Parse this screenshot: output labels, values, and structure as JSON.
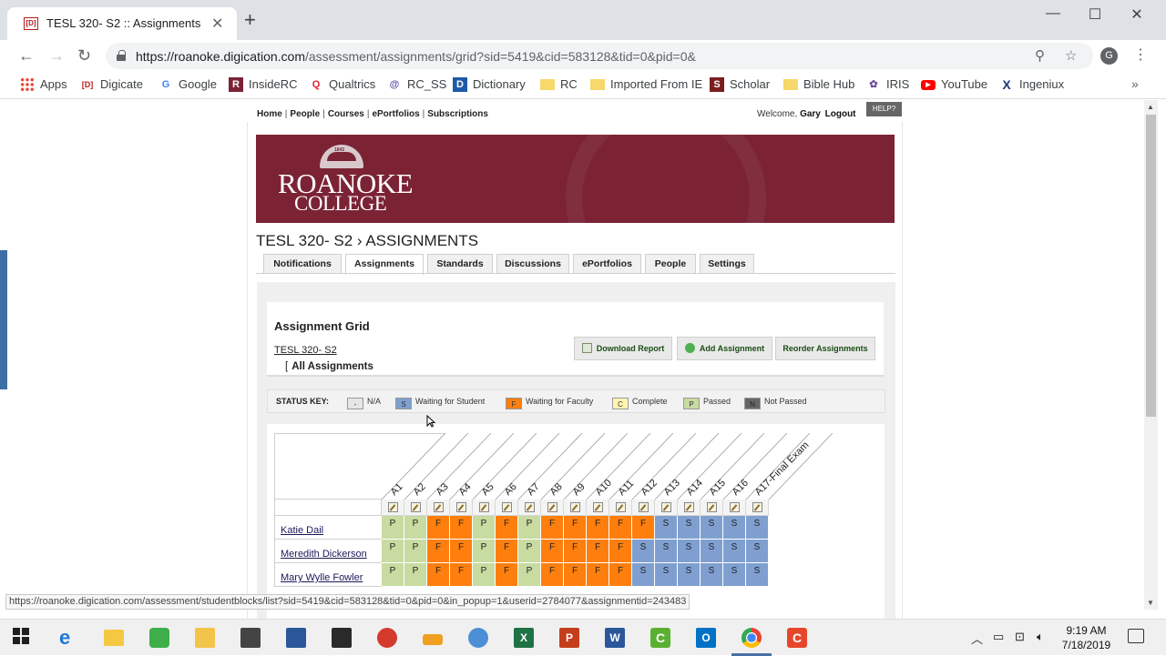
{
  "browser": {
    "tab_title": "TESL 320- S2 :: Assignments",
    "tab_favicon": "[D]",
    "new_tab": "+",
    "url_host": "https://roanoke.digication.com",
    "url_path": "/assessment/assignments/grid?sid=5419&cid=583128&tid=0&pid=0&",
    "profile_initial": "G",
    "bookmarks": [
      {
        "label": "Apps",
        "icon": "apps-grid-icon"
      },
      {
        "label": "Digicate",
        "icon": "[D]"
      },
      {
        "label": "Google",
        "icon": "G"
      },
      {
        "label": "InsideRC",
        "icon": "R"
      },
      {
        "label": "Qualtrics",
        "icon": "Q"
      },
      {
        "label": "RC_SS",
        "icon": "@"
      },
      {
        "label": "Dictionary",
        "icon": "D"
      },
      {
        "label": "RC",
        "icon": "folder-icon"
      },
      {
        "label": "Imported From IE",
        "icon": "folder-icon"
      },
      {
        "label": "Scholar",
        "icon": "S"
      },
      {
        "label": "Bible Hub",
        "icon": "folder-icon"
      },
      {
        "label": "IRIS",
        "icon": "iris-icon"
      },
      {
        "label": "YouTube",
        "icon": "youtube-icon"
      },
      {
        "label": "Ingeniux",
        "icon": "X"
      }
    ],
    "more_bookmarks": "»",
    "status_url": "https://roanoke.digication.com/assessment/studentblocks/list?sid=5419&cid=583128&tid=0&pid=0&in_popup=1&userid=2784077&assignmentid=243483"
  },
  "site": {
    "top_nav": [
      "Home",
      "People",
      "Courses",
      "ePortfolios",
      "Subscriptions"
    ],
    "welcome_prefix": "Welcome,",
    "user_name": "Gary",
    "logout": "Logout",
    "help": "HELP?",
    "logo_year": "1842",
    "logo_line1": "ROANOKE",
    "logo_line2": "COLLEGE"
  },
  "course": {
    "breadcrumb": "TESL 320- S2 › ASSIGNMENTS",
    "tabs": [
      "Notifications",
      "Assignments",
      "Standards",
      "Discussions",
      "ePortfolios",
      "People",
      "Settings"
    ],
    "active_tab": "Assignments"
  },
  "grid": {
    "title": "Assignment Grid",
    "course_link": "TESL 320- S2",
    "filter_bracket": "[",
    "filter": "All Assignments",
    "buttons": {
      "download": "Download Report",
      "add": "Add Assignment",
      "reorder": "Reorder Assignments"
    },
    "status_key_label": "STATUS KEY:",
    "status_key": [
      {
        "code": "-",
        "label": "N/A",
        "color": "#e6e6e6"
      },
      {
        "code": "S",
        "label": "Waiting for Student",
        "color": "#7f9fd0"
      },
      {
        "code": "F",
        "label": "Waiting for Faculty",
        "color": "#ff7f0e"
      },
      {
        "code": "C",
        "label": "Complete",
        "color": "#fff4b0"
      },
      {
        "code": "P",
        "label": "Passed",
        "color": "#c8dba0"
      },
      {
        "code": "N",
        "label": "Not Passed",
        "color": "#666666"
      }
    ],
    "assignments": [
      "A1",
      "A2",
      "A3",
      "A4",
      "A5",
      "A6",
      "A7",
      "A8",
      "A9",
      "A10",
      "A11",
      "A12",
      "A13",
      "A14",
      "A15",
      "A16",
      "A17-Final Exam"
    ],
    "students": [
      {
        "name": "Katie Dail",
        "statuses": [
          "P",
          "P",
          "F",
          "F",
          "P",
          "F",
          "P",
          "F",
          "F",
          "F",
          "F",
          "F",
          "S",
          "S",
          "S",
          "S",
          "S"
        ]
      },
      {
        "name": "Meredith Dickerson",
        "statuses": [
          "P",
          "P",
          "F",
          "F",
          "P",
          "F",
          "P",
          "F",
          "F",
          "F",
          "F",
          "S",
          "S",
          "S",
          "S",
          "S",
          "S"
        ]
      },
      {
        "name": "Mary Wylle Fowler",
        "statuses": [
          "P",
          "P",
          "F",
          "F",
          "P",
          "F",
          "P",
          "F",
          "F",
          "F",
          "F",
          "S",
          "S",
          "S",
          "S",
          "S",
          "S"
        ]
      }
    ]
  },
  "taskbar": {
    "time": "9:19 AM",
    "date": "7/18/2019"
  }
}
